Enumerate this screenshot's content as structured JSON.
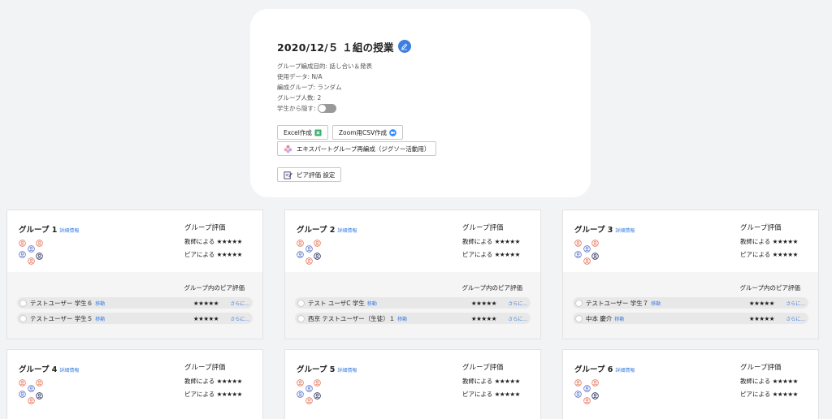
{
  "header": {
    "title": "2020/12/５ １組の授業",
    "purpose": "グループ編成目的: 話し合い＆発表",
    "data_used": "使用データ: N/A",
    "grouping": "編成グループ: ランダム",
    "group_size": "グループ人数: 2",
    "hide_label": "学生から隠す:",
    "excel_btn": "Excel作成",
    "zoom_btn": "Zoom用CSV作成",
    "expert_btn": "エキスパートグループ再編成（ジグソー活動用）",
    "peer_btn": "ピア評価 設定"
  },
  "labels": {
    "detail": "詳細情報",
    "group_eval": "グループ評価",
    "teacher": "教師による",
    "peer": "ピアによる",
    "peer_in_group": "グループ内のピア評価",
    "move": "移動",
    "more": "さらに...",
    "stars": "★★★★★"
  },
  "groups": [
    {
      "name": "グループ 1",
      "members": [
        "テストユーザー 学生６",
        "テストユーザー 学生５"
      ]
    },
    {
      "name": "グループ 2",
      "members": [
        "テスト ユーザC 学生",
        "西京 テストユーザー（生徒）１"
      ]
    },
    {
      "name": "グループ 3",
      "members": [
        "テストユーザー 学生７",
        "中本 慶介"
      ]
    },
    {
      "name": "グループ 4"
    },
    {
      "name": "グループ 5"
    },
    {
      "name": "グループ 6"
    }
  ],
  "colors": {
    "accent": "#3d7fe0",
    "avatar_orange": "#e8826a",
    "avatar_blue": "#6a7fd0",
    "avatar_dark": "#3a3f6a"
  }
}
